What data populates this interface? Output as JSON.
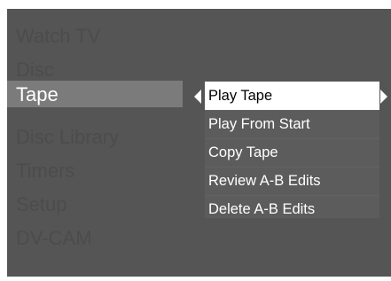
{
  "main_menu": {
    "items": [
      {
        "label": "Watch TV"
      },
      {
        "label": "Disc"
      },
      {
        "label": "Tape"
      },
      {
        "label": "Disc Library"
      },
      {
        "label": "Timers"
      },
      {
        "label": "Setup"
      },
      {
        "label": "DV-CAM"
      }
    ],
    "selected": "Tape"
  },
  "submenu": {
    "items": [
      {
        "label": "Play Tape"
      },
      {
        "label": "Play From Start"
      },
      {
        "label": "Copy Tape"
      },
      {
        "label": "Review A-B Edits"
      },
      {
        "label": "Delete A-B Edits"
      }
    ],
    "selected": "Play Tape"
  },
  "icons": {
    "left_arrow": "caret-left-icon",
    "right_arrow": "caret-right-icon"
  },
  "colors": {
    "background": "#555556",
    "dimmed_text": "#4c4c4d",
    "selected_main_bg": "#7b7b7c",
    "selected_sub_bg": "#ffffff"
  }
}
